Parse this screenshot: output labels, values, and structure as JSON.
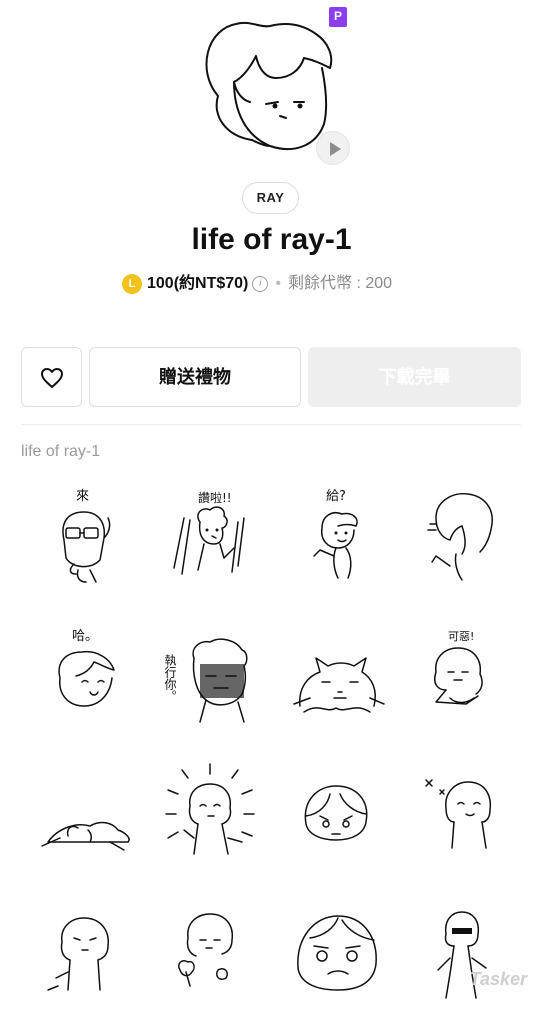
{
  "header": {
    "premium_badge": "P",
    "play_icon": "play-icon"
  },
  "author": {
    "name": "RAY"
  },
  "title": "life of ray-1",
  "price": {
    "coin_letter": "L",
    "amount": "100(約NT$70)",
    "info_symbol": "i",
    "remaining": "剩餘代幣 : 200"
  },
  "actions": {
    "like_icon": "heart-icon",
    "gift_label": "贈送禮物",
    "download_label": "下載完畢"
  },
  "section": {
    "label": "life of ray-1"
  },
  "stickers": [
    {
      "text": "來"
    },
    {
      "text": "讚啦!!"
    },
    {
      "text": "給?"
    },
    {
      "text": ""
    },
    {
      "text": "哈。"
    },
    {
      "text": "執行你。"
    },
    {
      "text": ""
    },
    {
      "text": "可惡!"
    },
    {
      "text": ""
    },
    {
      "text": ""
    },
    {
      "text": ""
    },
    {
      "text": ""
    },
    {
      "text": ""
    },
    {
      "text": ""
    },
    {
      "text": ""
    },
    {
      "text": ""
    }
  ],
  "watermark": "Tasker",
  "colors": {
    "coin": "#f2c21b",
    "premium": "#8b3df0",
    "disabled_button": "#eeeeee"
  }
}
